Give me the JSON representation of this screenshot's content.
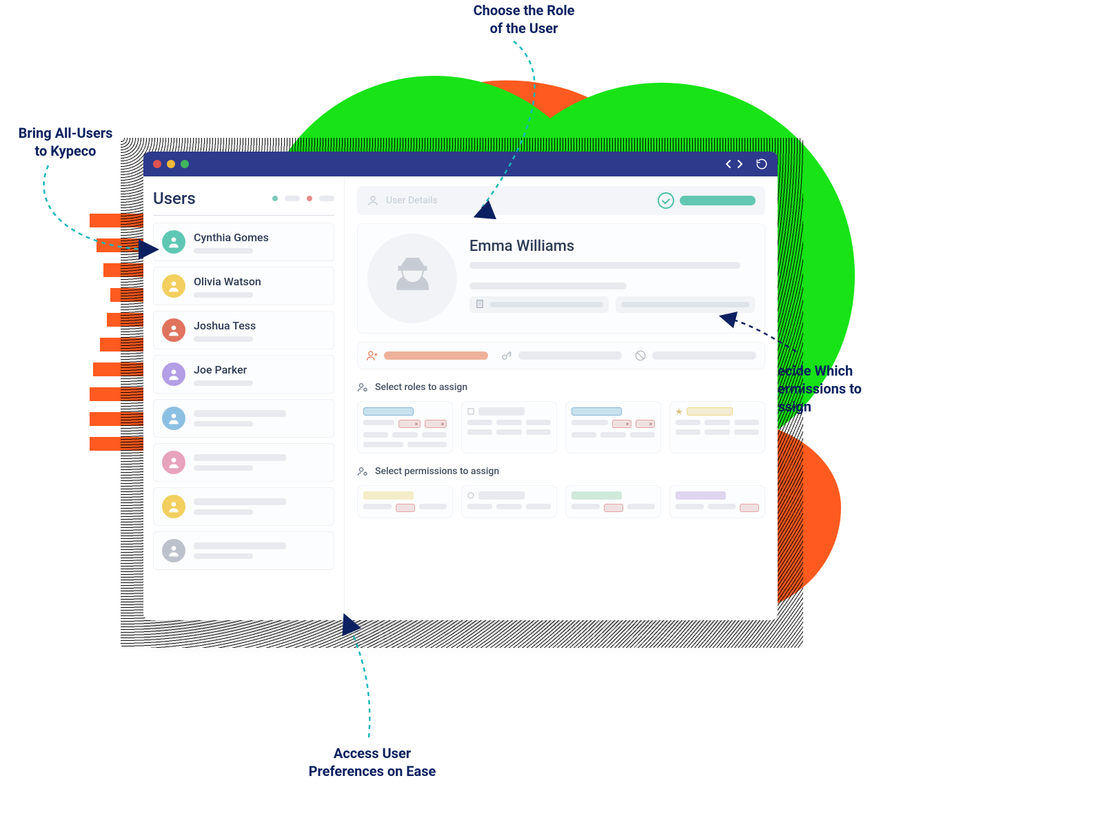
{
  "annotations": {
    "top": "Choose the Role\nof the User",
    "left": "Bring All-Users\nto Kypeco",
    "right": "Decide Which\nPermissions to\nAssign",
    "bottom": "Access User\nPreferences on Ease"
  },
  "window": {
    "dots": [
      "#e0524f",
      "#f0b93a",
      "#41b45e"
    ]
  },
  "sidebar": {
    "title": "Users",
    "users": [
      {
        "name": "Cynthia Gomes",
        "color": "#5ec7b4"
      },
      {
        "name": "Olivia Watson",
        "color": "#f2cf5e"
      },
      {
        "name": "Joshua Tess",
        "color": "#e0735d"
      },
      {
        "name": "Joe Parker",
        "color": "#b49ee6"
      },
      {
        "name": "",
        "color": "#8cc0e3"
      },
      {
        "name": "",
        "color": "#e8a3bd"
      },
      {
        "name": "",
        "color": "#f2cf5e"
      },
      {
        "name": "",
        "color": "#bcc2cc"
      }
    ]
  },
  "header": {
    "label": "User Details"
  },
  "profile": {
    "name": "Emma Williams"
  },
  "sections": {
    "roles": "Select roles to assign",
    "permissions": "Select permissions to assign"
  },
  "colors": {
    "accent_teal": "#4cc0a7",
    "accent_orange": "#e98a6a",
    "accent_blue": "#8ab6d6",
    "accent_yellow": "#f0d98c",
    "accent_green": "#b7e0c9",
    "accent_purple": "#cfc3ec",
    "accent_red": "#e4a3a3"
  }
}
